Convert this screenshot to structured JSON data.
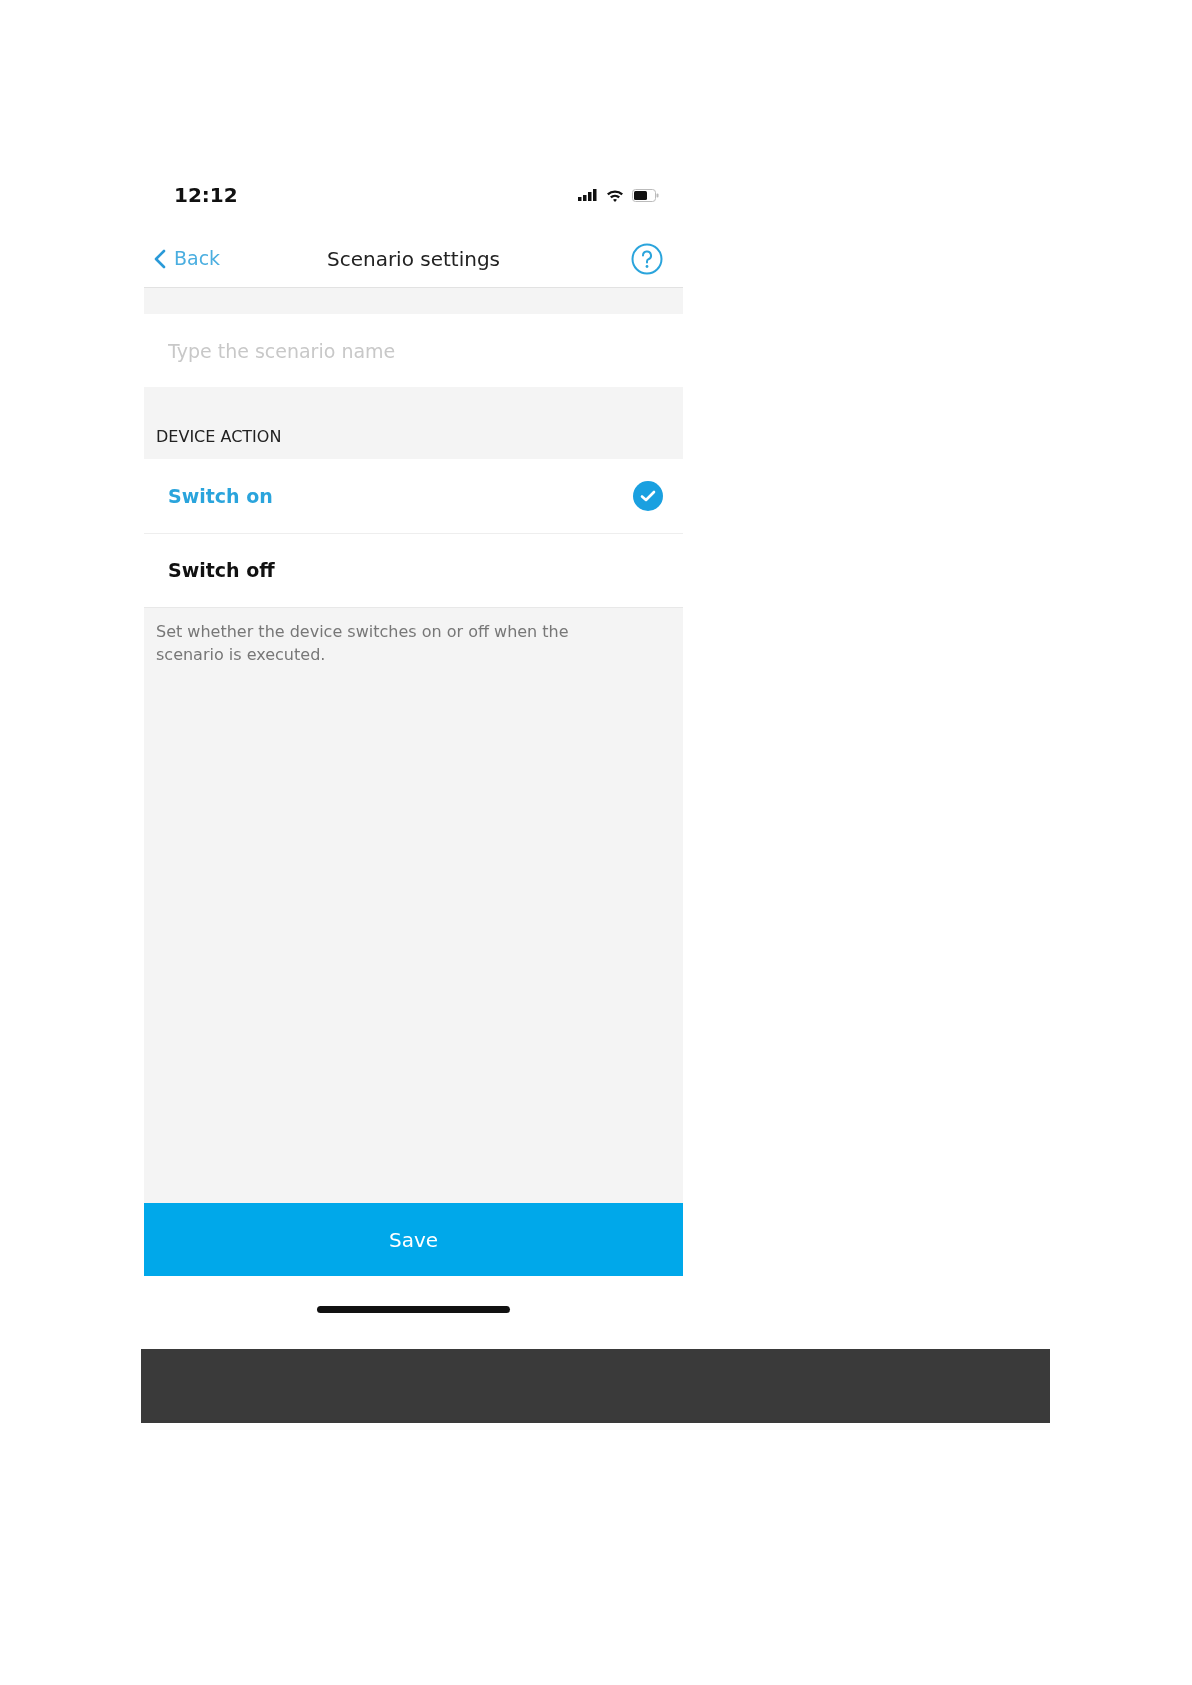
{
  "status_bar": {
    "time": "12:12"
  },
  "nav": {
    "back_label": "Back",
    "title": "Scenario settings"
  },
  "name_field": {
    "placeholder": "Type the scenario name"
  },
  "section": {
    "header": "DEVICE ACTION",
    "options": [
      {
        "label": "Switch on",
        "selected": true
      },
      {
        "label": "Switch off",
        "selected": false
      }
    ],
    "note": "Set whether the device switches on or off when the scenario is executed."
  },
  "save_button": {
    "label": "Save"
  }
}
